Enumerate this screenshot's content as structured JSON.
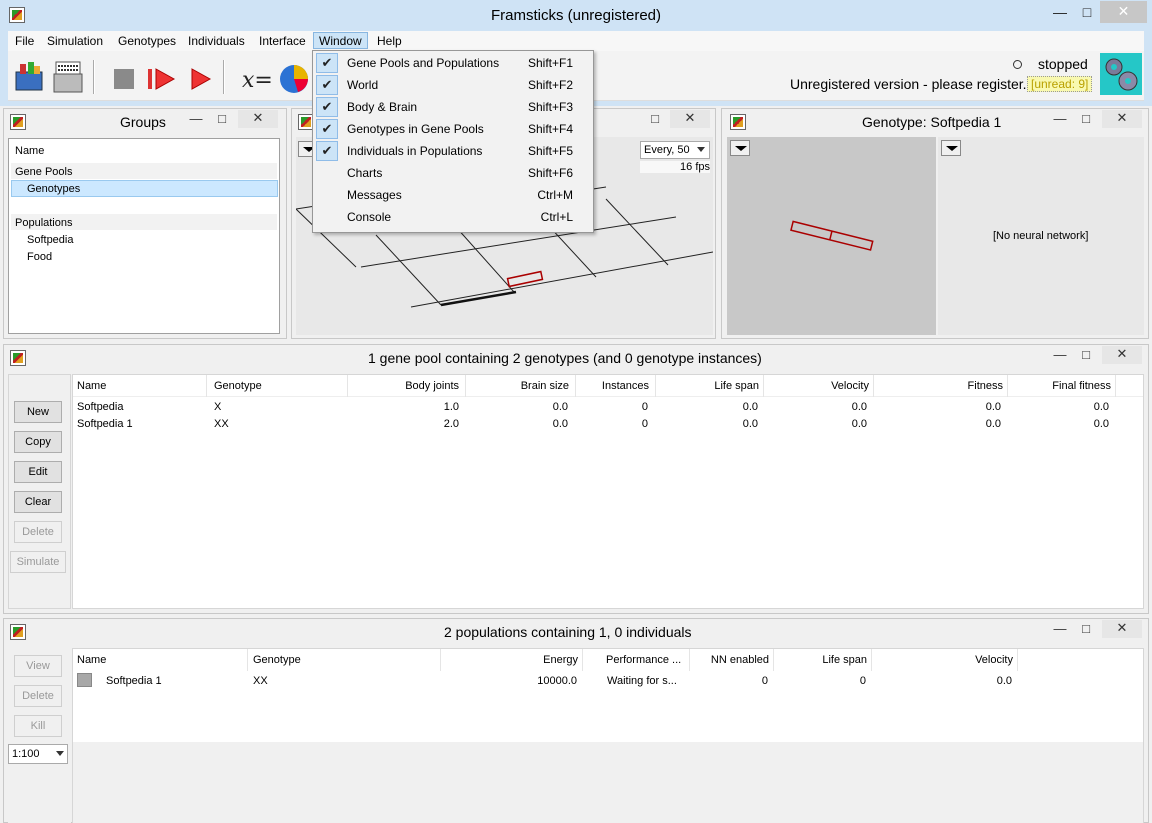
{
  "window": {
    "title": "Framsticks (unregistered)"
  },
  "menu": [
    "File",
    "Simulation",
    "Genotypes",
    "Individuals",
    "Interface",
    "Window",
    "Help"
  ],
  "status": {
    "state": "stopped",
    "register_msg": "Unregistered version - please register.",
    "unread": "[unread: 9]"
  },
  "window_menu": [
    {
      "label": "Gene Pools and Populations",
      "shortcut": "Shift+F1",
      "checked": true
    },
    {
      "label": "World",
      "shortcut": "Shift+F2",
      "checked": true
    },
    {
      "label": "Body & Brain",
      "shortcut": "Shift+F3",
      "checked": true
    },
    {
      "label": "Genotypes in Gene Pools",
      "shortcut": "Shift+F4",
      "checked": true
    },
    {
      "label": "Individuals in Populations",
      "shortcut": "Shift+F5",
      "checked": true
    },
    {
      "label": "Charts",
      "shortcut": "Shift+F6",
      "checked": false
    },
    {
      "label": "Messages",
      "shortcut": "Ctrl+M",
      "checked": false
    },
    {
      "label": "Console",
      "shortcut": "Ctrl+L",
      "checked": false
    }
  ],
  "groups": {
    "title": "Groups",
    "header": "Name",
    "gene_pools_label": "Gene Pools",
    "gene_pools": [
      "Genotypes"
    ],
    "populations_label": "Populations",
    "populations": [
      "Softpedia",
      "Food"
    ]
  },
  "world": {
    "refresh": "Every, 50",
    "fps": "16 fps"
  },
  "genotype_panel": {
    "title": "Genotype: Softpedia 1",
    "no_nn": "[No neural network]"
  },
  "genepool": {
    "title": "1 gene pool containing 2 genotypes (and 0 genotype instances)",
    "buttons": [
      "New",
      "Copy",
      "Edit",
      "Clear",
      "Delete",
      "Simulate"
    ],
    "columns": [
      "Name",
      "Genotype",
      "Body joints",
      "Brain size",
      "Instances",
      "Life span",
      "Velocity",
      "Fitness",
      "Final fitness"
    ],
    "rows": [
      [
        "Softpedia",
        "X",
        "1.0",
        "0.0",
        "0",
        "0.0",
        "0.0",
        "0.0",
        "0.0"
      ],
      [
        "Softpedia 1",
        "XX",
        "2.0",
        "0.0",
        "0",
        "0.0",
        "0.0",
        "0.0",
        "0.0"
      ]
    ]
  },
  "populations": {
    "title": "2 populations containing 1, 0 individuals",
    "buttons": [
      "View",
      "Delete",
      "Kill"
    ],
    "zoom": "1:100",
    "columns": [
      "Name",
      "Genotype",
      "Energy",
      "Performance ...",
      "NN enabled",
      "Life span",
      "Velocity"
    ],
    "rows": [
      [
        "Softpedia 1",
        "XX",
        "10000.0",
        "Waiting for s...",
        "0",
        "0",
        "0.0"
      ]
    ]
  },
  "window_controls": {
    "minimize": "—",
    "maximize": "□",
    "close": "✕"
  }
}
